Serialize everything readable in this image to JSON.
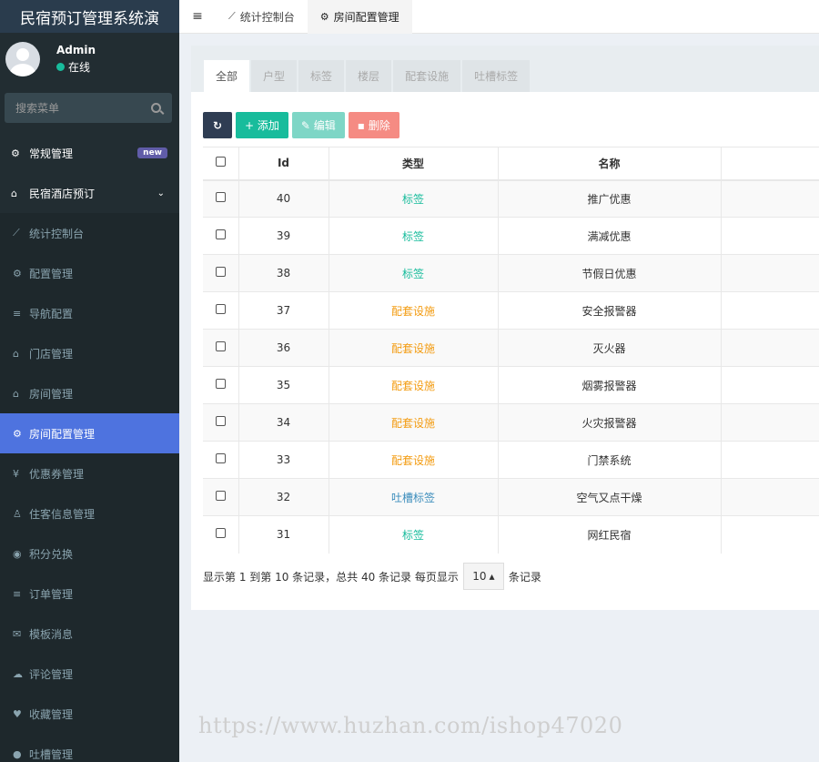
{
  "app": {
    "title": "民宿预订管理系统演"
  },
  "user": {
    "name": "Admin",
    "status": "在线"
  },
  "sidebar": {
    "search_placeholder": "搜索菜单",
    "groups": [
      {
        "label": "常规管理",
        "badge": "new",
        "icon": "cogs-icon"
      },
      {
        "label": "民宿酒店预订",
        "icon": "home-icon"
      }
    ],
    "items": [
      {
        "label": "统计控制台",
        "icon": "chart-icon"
      },
      {
        "label": "配置管理",
        "icon": "gear-icon"
      },
      {
        "label": "导航配置",
        "icon": "bars-icon"
      },
      {
        "label": "门店管理",
        "icon": "bank-icon"
      },
      {
        "label": "房间管理",
        "icon": "home-icon"
      },
      {
        "label": "房间配置管理",
        "icon": "gear-icon",
        "active": true
      },
      {
        "label": "优惠券管理",
        "icon": "yen-icon"
      },
      {
        "label": "住客信息管理",
        "icon": "user-icon"
      },
      {
        "label": "积分兑换",
        "icon": "points-icon"
      },
      {
        "label": "订单管理",
        "icon": "bars-icon"
      },
      {
        "label": "模板消息",
        "icon": "envelope-icon"
      },
      {
        "label": "评论管理",
        "icon": "comments-icon"
      },
      {
        "label": "收藏管理",
        "icon": "heart-icon"
      },
      {
        "label": "吐槽管理",
        "icon": "comment-icon"
      }
    ]
  },
  "topbar": {
    "tabs": [
      {
        "label": "统计控制台",
        "icon": "chart-icon"
      },
      {
        "label": "房间配置管理",
        "icon": "gear-icon"
      }
    ]
  },
  "panel": {
    "tabs": [
      "全部",
      "户型",
      "标签",
      "楼层",
      "配套设施",
      "吐槽标签"
    ]
  },
  "toolbar": {
    "add_label": "添加",
    "edit_label": "编辑",
    "delete_label": "删除"
  },
  "table": {
    "headers": [
      "Id",
      "类型",
      "名称"
    ],
    "rows": [
      {
        "id": "40",
        "type": "标签",
        "name": "推广优惠"
      },
      {
        "id": "39",
        "type": "标签",
        "name": "满减优惠"
      },
      {
        "id": "38",
        "type": "标签",
        "name": "节假日优惠"
      },
      {
        "id": "37",
        "type": "配套设施",
        "name": "安全报警器"
      },
      {
        "id": "36",
        "type": "配套设施",
        "name": "灭火器"
      },
      {
        "id": "35",
        "type": "配套设施",
        "name": "烟雾报警器"
      },
      {
        "id": "34",
        "type": "配套设施",
        "name": "火灾报警器"
      },
      {
        "id": "33",
        "type": "配套设施",
        "name": "门禁系统"
      },
      {
        "id": "32",
        "type": "吐槽标签",
        "name": "空气又点干燥"
      },
      {
        "id": "31",
        "type": "标签",
        "name": "网红民宿"
      }
    ]
  },
  "pager": {
    "summary": "显示第 1 到第 10 条记录，总共 40 条记录 每页显示",
    "page_size": "10",
    "suffix": "条记录"
  },
  "watermark": "https://www.huzhan.com/ishop47020",
  "colors": {
    "accent": "#4e73df",
    "green": "#18bc9c",
    "orange": "#f39c12",
    "blue": "#3c8dbc"
  }
}
